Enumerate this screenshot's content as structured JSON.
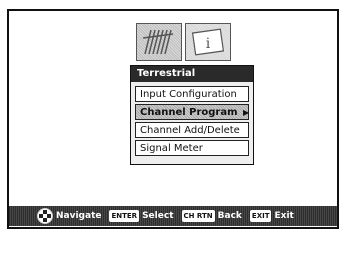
{
  "menu": {
    "title": "Terrestrial",
    "items": [
      {
        "label": "Input Configuration"
      },
      {
        "label": "Channel Program",
        "selected": true,
        "arrow": "▶"
      },
      {
        "label": "Channel Add/Delete"
      },
      {
        "label": "Signal Meter"
      }
    ]
  },
  "icons": [
    "antenna-icon",
    "info-icon"
  ],
  "footer": {
    "navigate_label": "Navigate",
    "enter_key": "ENTER",
    "select_label": "Select",
    "chrtn_key": "CH RTN",
    "back_label": "Back",
    "exit_key": "EXIT",
    "exit_label": "Exit"
  }
}
